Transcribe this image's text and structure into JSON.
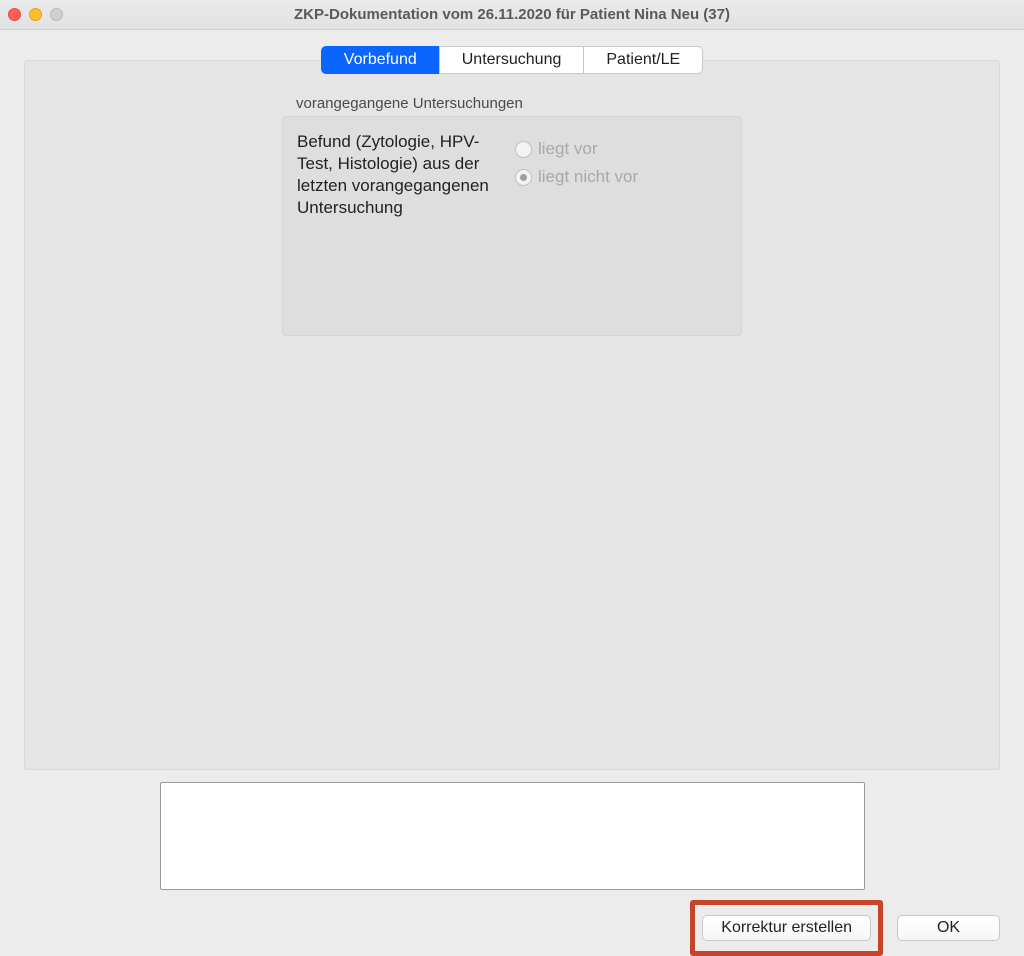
{
  "window": {
    "title": "ZKP-Dokumentation vom 26.11.2020 für Patient Nina Neu (37)"
  },
  "tabs": [
    {
      "label": "Vorbefund",
      "active": true
    },
    {
      "label": "Untersuchung",
      "active": false
    },
    {
      "label": "Patient/LE",
      "active": false
    }
  ],
  "form": {
    "caption": "vorangegangene Untersuchungen",
    "label": "Befund (Zytologie, HPV-Test, Histologie) aus der letzten vorangegangenen Untersuchung",
    "options": [
      {
        "label": "liegt vor",
        "selected": false,
        "disabled": true
      },
      {
        "label": "liegt nicht vor",
        "selected": true,
        "disabled": true
      }
    ]
  },
  "note": {
    "value": ""
  },
  "buttons": {
    "korrektur": "Korrektur erstellen",
    "ok": "OK"
  }
}
